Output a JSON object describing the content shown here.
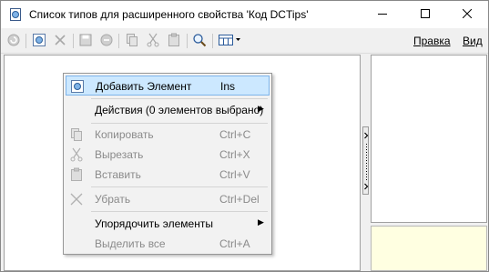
{
  "window": {
    "title": "Список типов для расширенного свойства 'Код DCTips'",
    "minimize_icon": "minimize-icon",
    "maximize_icon": "maximize-icon",
    "close_icon": "close-icon"
  },
  "toolbar": {
    "buttons": [
      "refresh-icon",
      "add-element-icon",
      "delete-icon",
      "save-icon",
      "cancel-icon",
      "copy-icon",
      "cut-icon",
      "paste-icon",
      "search-icon",
      "view-icon"
    ],
    "menu_edit": "Правка",
    "menu_view": "Вид"
  },
  "context_menu": {
    "items": [
      {
        "label": "Добавить Элемент",
        "shortcut": "Ins",
        "enabled": true,
        "selected": true,
        "icon": "add-element-icon"
      },
      {
        "label": "Действия (0 элементов выбрано)",
        "shortcut": "",
        "enabled": true,
        "submenu": true
      },
      {
        "label": "Копировать",
        "shortcut": "Ctrl+C",
        "enabled": false,
        "icon": "copy-icon"
      },
      {
        "label": "Вырезать",
        "shortcut": "Ctrl+X",
        "enabled": false,
        "icon": "cut-icon"
      },
      {
        "label": "Вставить",
        "shortcut": "Ctrl+V",
        "enabled": false,
        "icon": "paste-icon"
      },
      {
        "label": "Убрать",
        "shortcut": "Ctrl+Del",
        "enabled": false,
        "icon": "remove-icon"
      },
      {
        "label": "Упорядочить элементы",
        "shortcut": "",
        "enabled": true,
        "submenu": true
      },
      {
        "label": "Выделить все",
        "shortcut": "Ctrl+A",
        "enabled": false
      }
    ]
  },
  "colors": {
    "selection_bg": "#cce8ff",
    "selection_border": "#7eb4ea",
    "info_pane_bg": "#ffffe1",
    "disabled_text": "#8a8a8a"
  }
}
